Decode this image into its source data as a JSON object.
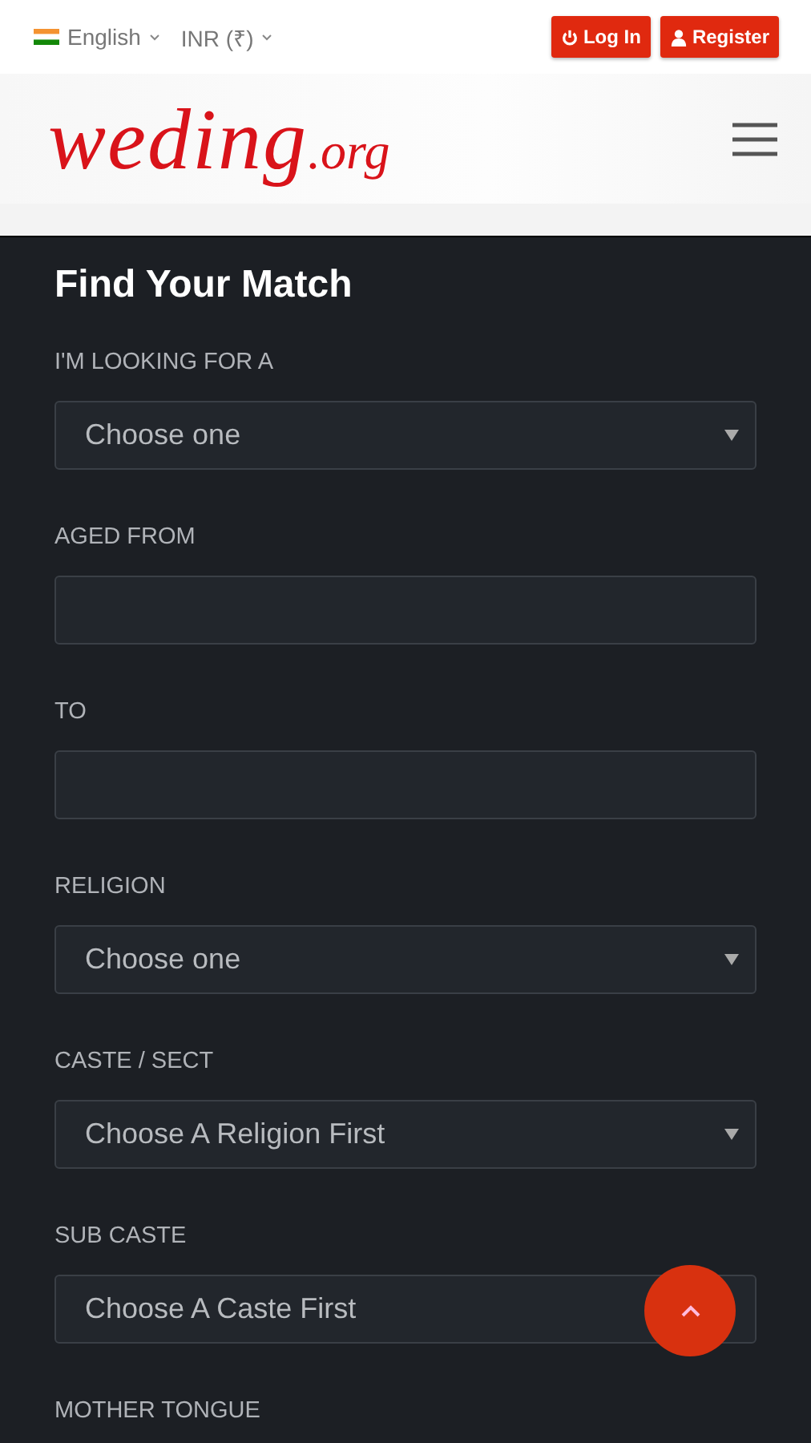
{
  "topbar": {
    "language": "English",
    "currency": "INR (₹)",
    "buttons": [
      {
        "kind": "login",
        "label": "Log In"
      },
      {
        "kind": "register",
        "label": "Register"
      }
    ]
  },
  "logo": {
    "name": "weding",
    "suffix": ".org"
  },
  "form": {
    "title": "Find Your Match",
    "fields": [
      {
        "label": "I'M LOOKING FOR A",
        "kind": "select",
        "value": "Choose one"
      },
      {
        "label": "AGED FROM",
        "kind": "input"
      },
      {
        "label": "TO",
        "kind": "input"
      },
      {
        "label": "RELIGION",
        "kind": "select",
        "value": "Choose one"
      },
      {
        "label": "CASTE / SECT",
        "kind": "select",
        "value": "Choose A Religion First"
      },
      {
        "label": "SUB CASTE",
        "kind": "select",
        "value": "Choose A Caste First",
        "arrow": false
      },
      {
        "label": "MOTHER TONGUE",
        "kind": "label"
      }
    ]
  }
}
